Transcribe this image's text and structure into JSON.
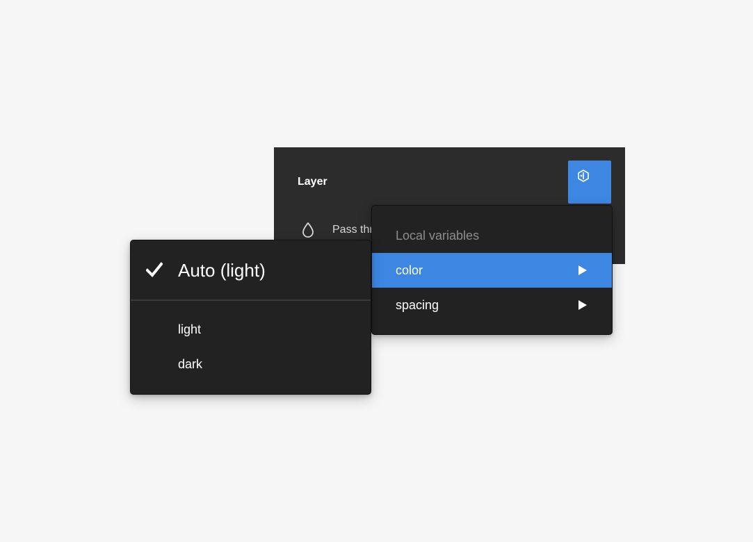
{
  "layer_panel": {
    "title": "Layer",
    "blend_mode_label": "Pass through",
    "icons": {
      "variable_button": "variable-hexagon-icon",
      "blend": "droplet-icon"
    }
  },
  "variables_menu": {
    "header": "Local variables",
    "items": [
      {
        "label": "color",
        "selected": true,
        "icon": "chevron-right-icon"
      },
      {
        "label": "spacing",
        "selected": false,
        "icon": "chevron-right-icon"
      }
    ]
  },
  "mode_menu": {
    "selected_label": "Auto (light)",
    "options": [
      {
        "label": "light"
      },
      {
        "label": "dark"
      }
    ]
  },
  "colors": {
    "accent": "#3d87e3",
    "panel": "#2c2c2c",
    "menu": "#222222",
    "background": "#f6f6f6"
  }
}
